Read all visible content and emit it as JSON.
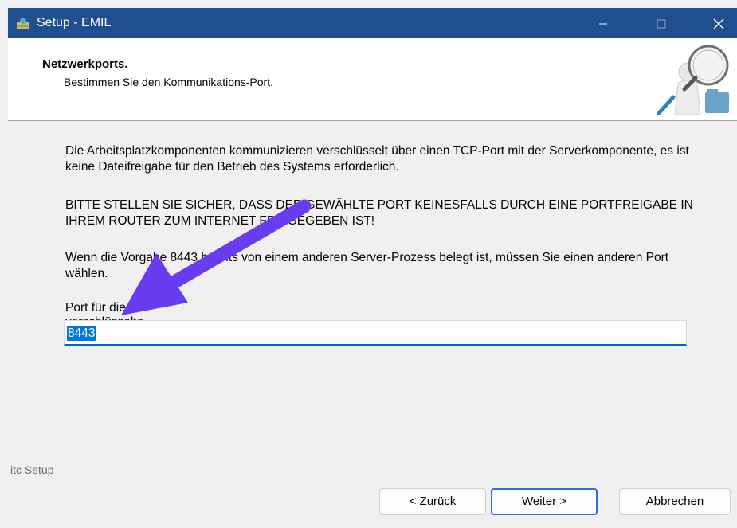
{
  "window": {
    "title": "Setup - EMIL",
    "controls": {
      "minimize_icon": "minimize-icon",
      "maximize_icon": "maximize-icon",
      "close_icon": "close-icon"
    }
  },
  "header": {
    "title": "Netzwerkports.",
    "subtitle": "Bestimmen Sie den Kommunikations-Port.",
    "image": "magnifier-figure-icon"
  },
  "content": {
    "paragraph1": "Die Arbeitsplatzkomponenten kommunizieren verschlüsselt über einen TCP-Port mit der Serverkomponente, es ist keine Dateifreigabe für den Betrieb des Systems erforderlich.",
    "paragraph2": "BITTE STELLEN SIE SICHER, DASS DER GEWÄHLTE PORT KEINESFALLS DURCH EINE PORTFREIGABE IN IHREM ROUTER ZUM INTERNET FREIGEGEBEN IST!",
    "paragraph3": "Wenn die Vorgabe 8443 bereits von einem anderen Server-Prozess belegt ist, müssen Sie einen anderen Port wählen.",
    "port_label": "Port für die verschlüsselte Datenübertragung:",
    "port_value": "8443"
  },
  "footer": {
    "group_label": "itc Setup",
    "back_label": "< Zurück",
    "next_label": "Weiter >",
    "cancel_label": "Abbrechen"
  },
  "annotation": {
    "arrow_color": "#6a3cf0"
  }
}
